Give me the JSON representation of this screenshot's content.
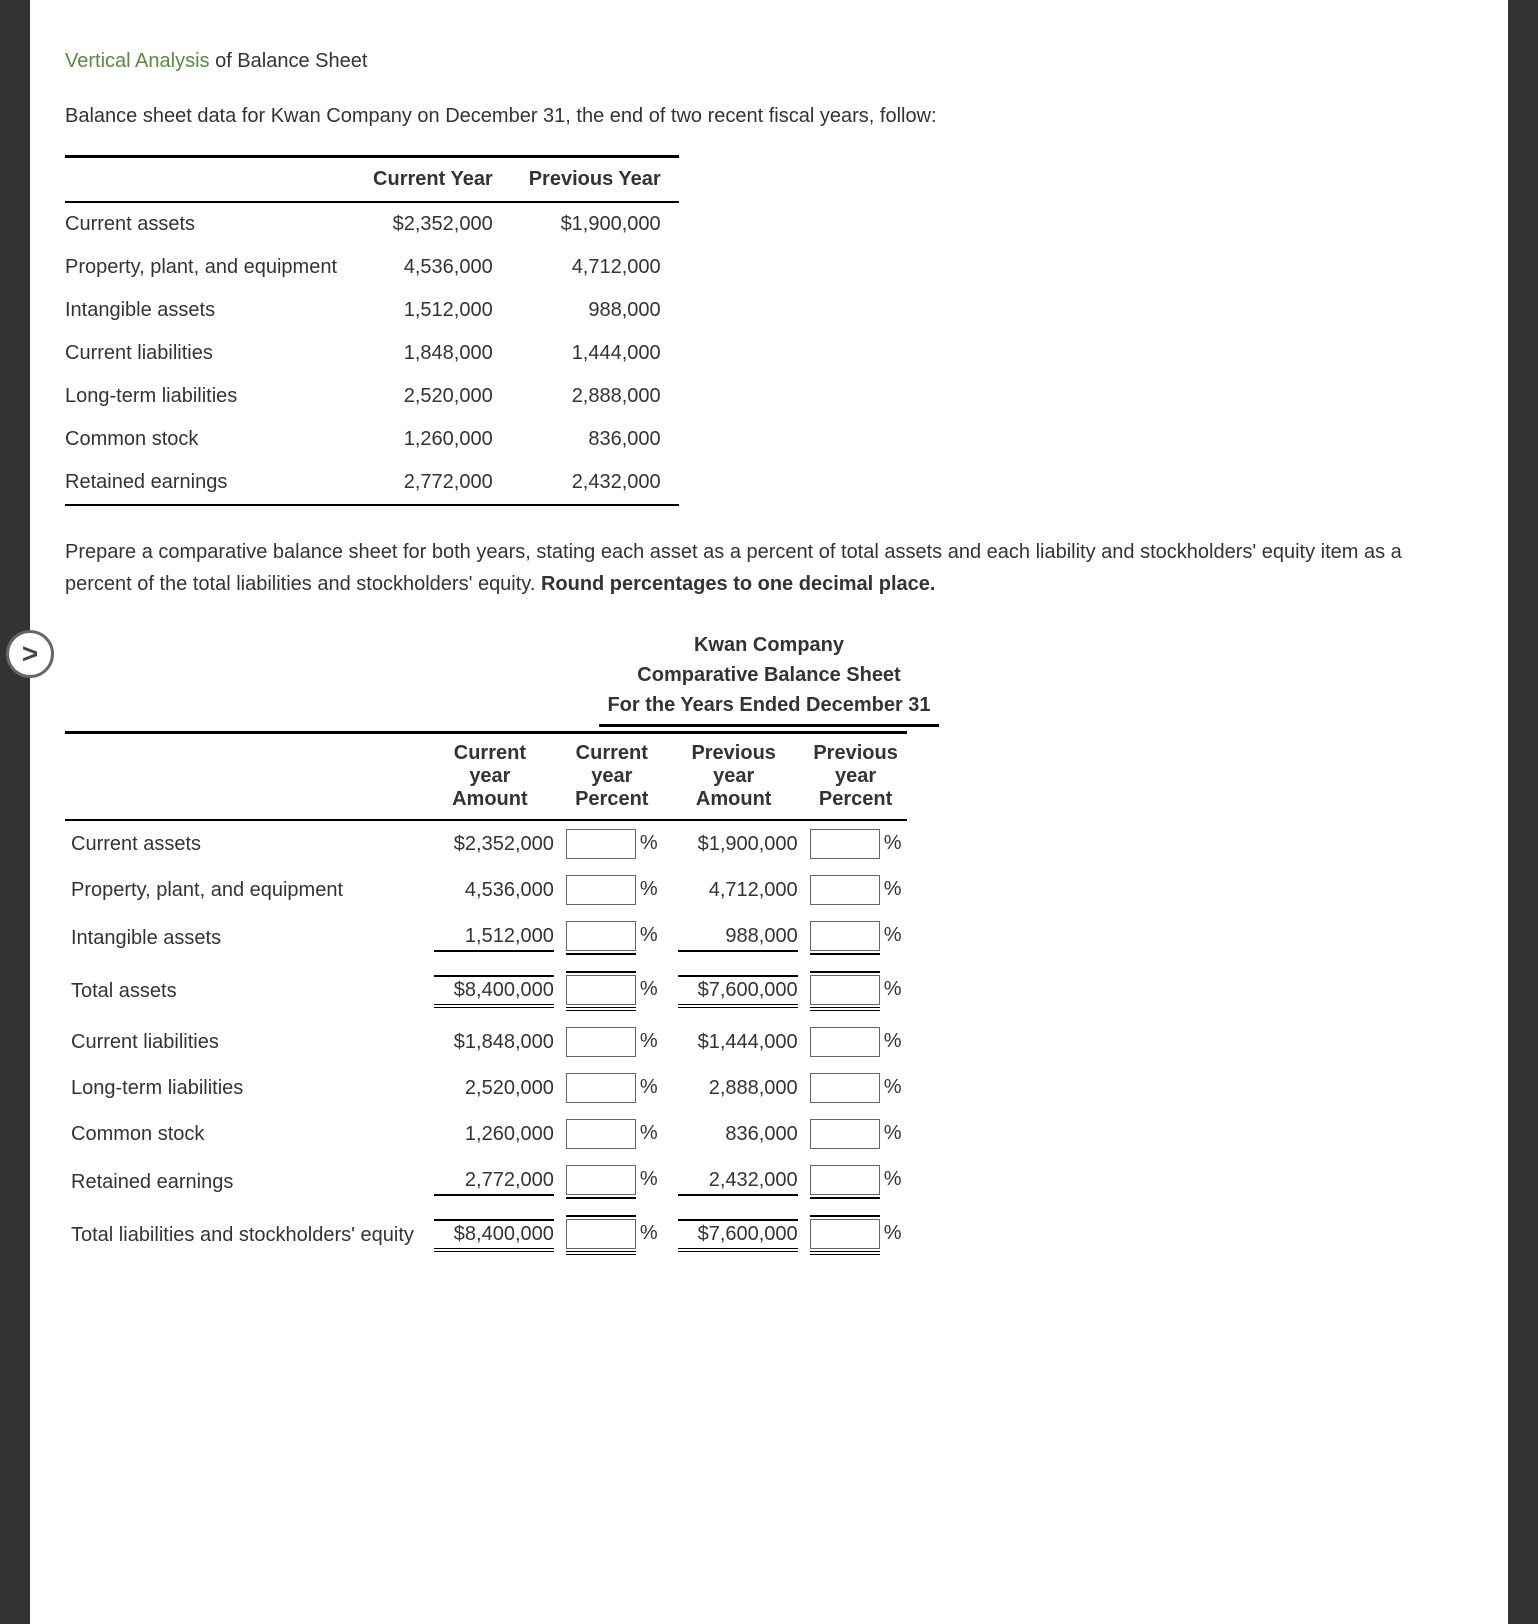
{
  "title": {
    "green": "Vertical Analysis",
    "rest": " of Balance Sheet"
  },
  "intro": "Balance sheet data for Kwan Company on December 31, the end of two recent fiscal years, follow:",
  "data_table": {
    "headers": {
      "blank": "",
      "cy": "Current Year",
      "py": "Previous Year"
    },
    "rows": [
      {
        "label": "Current assets",
        "cy": "$2,352,000",
        "py": "$1,900,000"
      },
      {
        "label": "Property, plant, and equipment",
        "cy": "4,536,000",
        "py": "4,712,000"
      },
      {
        "label": "Intangible assets",
        "cy": "1,512,000",
        "py": "988,000"
      },
      {
        "label": "Current liabilities",
        "cy": "1,848,000",
        "py": "1,444,000"
      },
      {
        "label": "Long-term liabilities",
        "cy": "2,520,000",
        "py": "2,888,000"
      },
      {
        "label": "Common stock",
        "cy": "1,260,000",
        "py": "836,000"
      },
      {
        "label": "Retained earnings",
        "cy": "2,772,000",
        "py": "2,432,000"
      }
    ]
  },
  "instructions": {
    "part1": "Prepare a comparative balance sheet for both years, stating each asset as a percent of total assets and each liability and stockholders' equity item as a percent of the total liabilities and stockholders' equity. ",
    "bold": "Round percentages to one decimal place."
  },
  "worksheet": {
    "title": {
      "l1": "Kwan Company",
      "l2": "Comparative Balance Sheet",
      "l3": "For the Years Ended December 31"
    },
    "headers": {
      "blank": "",
      "cya1": "Current",
      "cya2": "year",
      "cya3": "Amount",
      "cyp1": "Current",
      "cyp2": "year",
      "cyp3": "Percent",
      "pya1": "Previous",
      "pya2": "year",
      "pya3": "Amount",
      "pyp1": "Previous",
      "pyp2": "year",
      "pyp3": "Percent"
    },
    "rows": [
      {
        "label": "Current assets",
        "cy": "$2,352,000",
        "py": "$1,900,000",
        "type": "plain"
      },
      {
        "label": "Property, plant, and equipment",
        "cy": "4,536,000",
        "py": "4,712,000",
        "type": "plain"
      },
      {
        "label": "Intangible assets",
        "cy": "1,512,000",
        "py": "988,000",
        "type": "sub"
      },
      {
        "label": "Total assets",
        "cy": "$8,400,000",
        "py": "$7,600,000",
        "type": "total"
      },
      {
        "label": "Current liabilities",
        "cy": "$1,848,000",
        "py": "$1,444,000",
        "type": "plain"
      },
      {
        "label": "Long-term liabilities",
        "cy": "2,520,000",
        "py": "2,888,000",
        "type": "plain"
      },
      {
        "label": "Common stock",
        "cy": "1,260,000",
        "py": "836,000",
        "type": "plain"
      },
      {
        "label": "Retained earnings",
        "cy": "2,772,000",
        "py": "2,432,000",
        "type": "sub"
      },
      {
        "label": "Total liabilities and stockholders' equity",
        "cy": "$8,400,000",
        "py": "$7,600,000",
        "type": "total"
      }
    ],
    "pct_sign": "%"
  },
  "nav": {
    "arrow": ">"
  }
}
